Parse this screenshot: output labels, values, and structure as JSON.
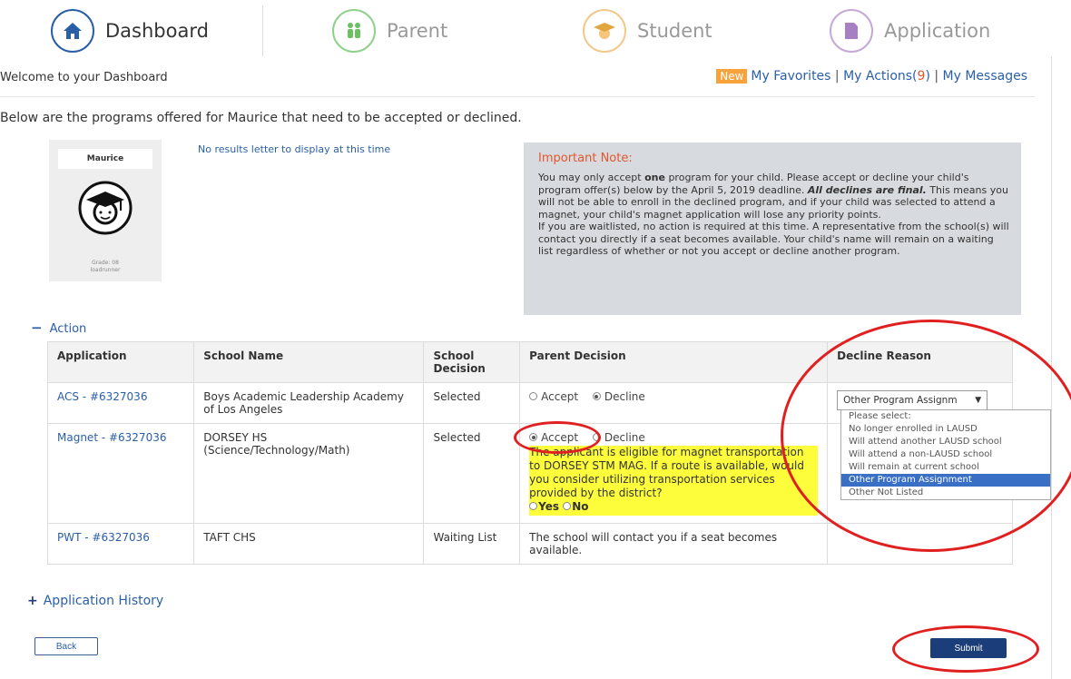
{
  "tabs": [
    {
      "label": "Dashboard",
      "icon": "home-icon",
      "active": true
    },
    {
      "label": "Parent",
      "icon": "family-icon",
      "active": false
    },
    {
      "label": "Student",
      "icon": "graduation-cap-icon",
      "active": false
    },
    {
      "label": "Application",
      "icon": "document-icon",
      "active": false
    }
  ],
  "header": {
    "welcome": "Welcome to your Dashboard",
    "new_badge": "New",
    "favorites": "My Favorites",
    "separator": "|",
    "actions": "My Actions(",
    "actions_count": "9",
    "actions_close": ")",
    "messages": "My Messages"
  },
  "intro": "Below are the programs offered for Maurice that need to be accepted or declined.",
  "student_card": {
    "name": "Maurice",
    "grade": "Grade: 08",
    "username": "loadrunner"
  },
  "no_results": "No results letter to display at this time",
  "note": {
    "title": "Important Note:",
    "p1_a": "You may only accept ",
    "p1_bold": "one",
    "p1_b": " program for your child. Please accept or decline your child's program offer(s) below by the April 5, 2019 deadline. ",
    "p1_bolditalic": "All declines are final.",
    "p1_c": " This means you will not be able to enroll in the declined program, and if your child was selected to attend a magnet, your child's magnet application will lose any priority points.",
    "p2": "If you are waitlisted, no action is required at this time. A representative from the school(s) will contact you directly if a seat becomes available. Your child's name will remain on a waiting list regardless of whether or not you accept or decline another program."
  },
  "action_section": {
    "toggle": "−",
    "label": "Action"
  },
  "table": {
    "headers": {
      "application": "Application",
      "school_name": "School Name",
      "school_decision": "School Decision",
      "parent_decision": "Parent Decision",
      "decline_reason": "Decline Reason"
    },
    "rows": [
      {
        "application": "ACS - #6327036",
        "school": "Boys Academic Leadership Academy of Los Angeles",
        "decision": "Selected",
        "accept": "Accept",
        "decline": "Decline",
        "selected": "decline",
        "reason": "Other Program Assignm"
      },
      {
        "application": "Magnet - #6327036",
        "school": "DORSEY HS (Science/Technology/Math)",
        "decision": "Selected",
        "accept": "Accept",
        "decline": "Decline",
        "selected": "accept",
        "transport_question": "The applicant is eligible for magnet transportation to DORSEY STM MAG. If a route is available, would you consider utilizing transportation services provided by the district?",
        "yes": "Yes",
        "no": "No"
      },
      {
        "application": "PWT - #6327036",
        "school": "TAFT CHS",
        "decision": "Waiting List",
        "message": "The school will contact you if a seat becomes available."
      }
    ]
  },
  "decline_options": [
    {
      "label": "Please select:",
      "selected": false
    },
    {
      "label": "No longer enrolled in LAUSD",
      "selected": false
    },
    {
      "label": "Will attend another LAUSD school",
      "selected": false
    },
    {
      "label": "Will attend a non-LAUSD school",
      "selected": false
    },
    {
      "label": "Will remain at current school",
      "selected": false
    },
    {
      "label": "Other Program Assignment",
      "selected": true
    },
    {
      "label": "Other Not Listed",
      "selected": false
    }
  ],
  "history_section": {
    "toggle": "+",
    "label": "Application History"
  },
  "buttons": {
    "back": "Back",
    "submit": "Submit"
  },
  "colors": {
    "link": "#2a5fa8",
    "badge": "#f7a23b",
    "note_title": "#e4572e",
    "highlight": "#fdfd3c",
    "submit": "#1b3d7a",
    "annotation": "#e02020"
  }
}
